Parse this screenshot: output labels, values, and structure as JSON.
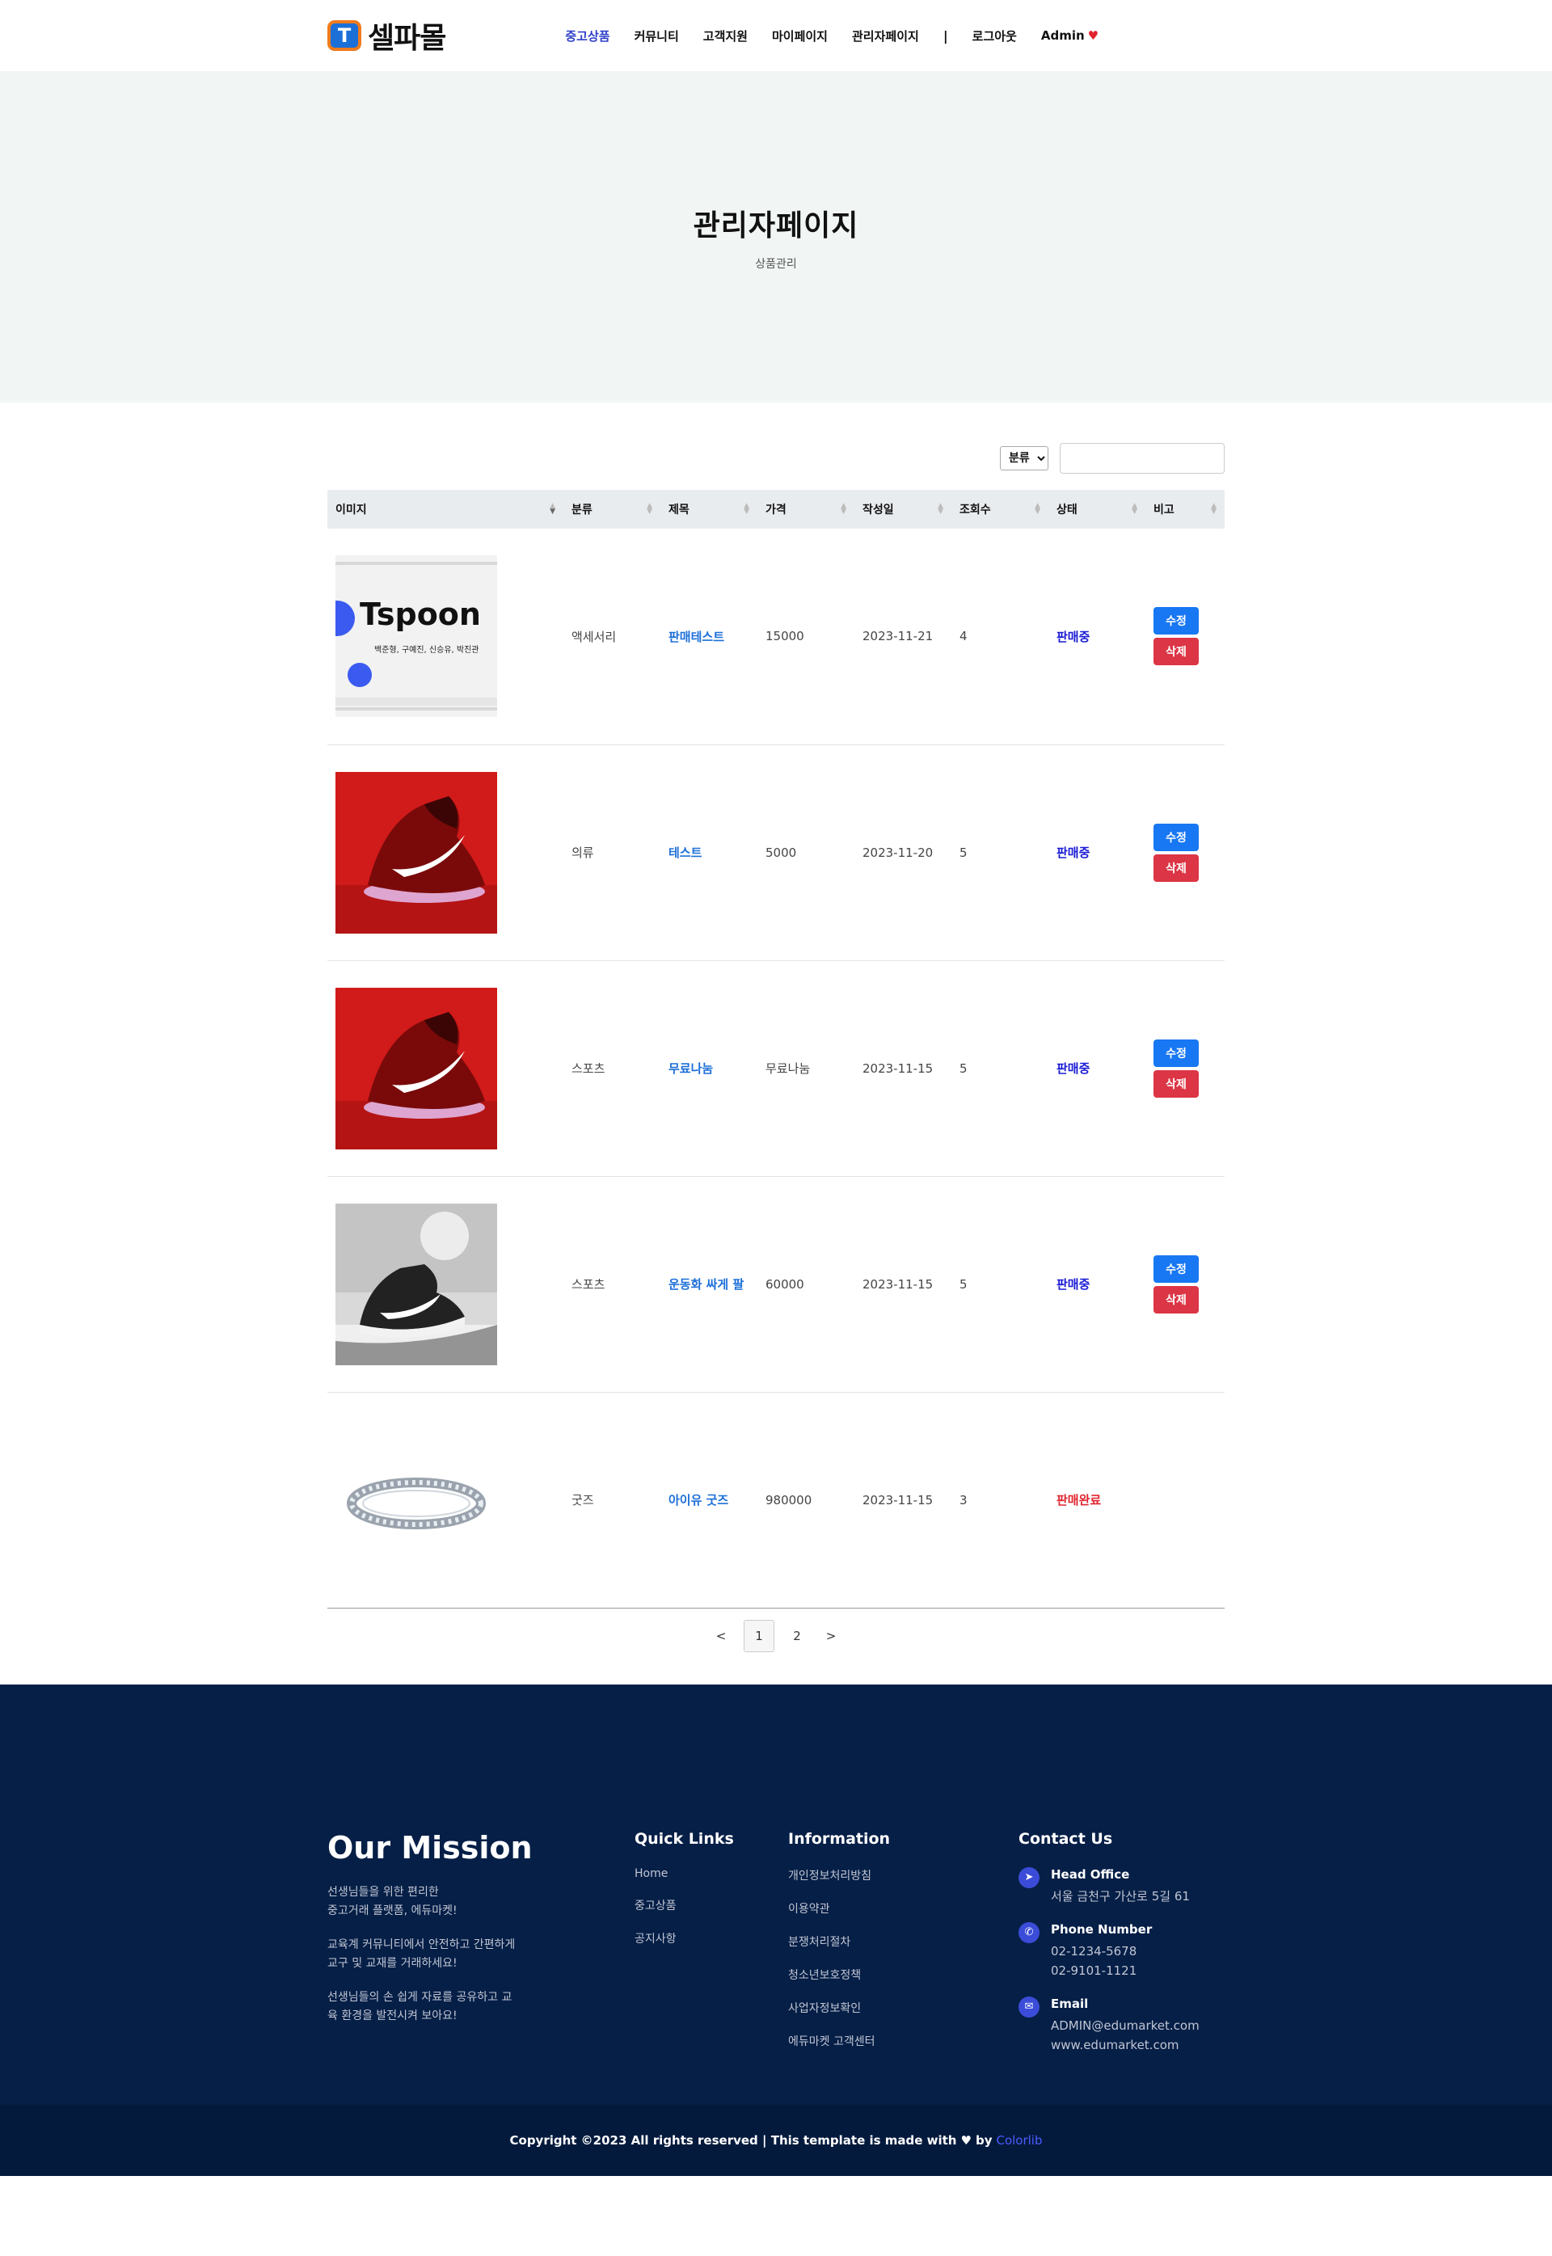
{
  "brand": {
    "logo_letter": "T",
    "name": "셀파몰"
  },
  "nav": {
    "items": [
      "중고상품",
      "커뮤니티",
      "고객지원",
      "마이페이지",
      "관리자페이지"
    ],
    "separator": "|",
    "logout": "로그아웃",
    "user": "Admin"
  },
  "hero": {
    "title": "관리자페이지",
    "subtitle": "상품관리"
  },
  "filter": {
    "select_value": "분류",
    "search_value": ""
  },
  "table": {
    "headers": [
      "이미지",
      "분류",
      "제목",
      "가격",
      "작성일",
      "조회수",
      "상태",
      "비고"
    ],
    "rows": [
      {
        "image": "tspoon-banner-image",
        "category": "액세서리",
        "title": "판매테스트",
        "price": "15000",
        "date": "2023-11-21",
        "views": "4",
        "status": "판매중",
        "edit": "수정",
        "delete": "삭제"
      },
      {
        "image": "red-sneaker-image",
        "category": "의류",
        "title": "테스트",
        "price": "5000",
        "date": "2023-11-20",
        "views": "5",
        "status": "판매중",
        "edit": "수정",
        "delete": "삭제"
      },
      {
        "image": "red-sneaker-image",
        "category": "스포츠",
        "title": "무료나눔",
        "price": "무료나눔",
        "date": "2023-11-15",
        "views": "5",
        "status": "판매중",
        "edit": "수정",
        "delete": "삭제"
      },
      {
        "image": "black-sneaker-image",
        "category": "스포츠",
        "title": "운동화 싸게 팔",
        "price": "60000",
        "date": "2023-11-15",
        "views": "5",
        "status": "판매중",
        "edit": "수정",
        "delete": "삭제"
      },
      {
        "image": "diamond-ring-image",
        "category": "굿즈",
        "title": "아이유 굿즈",
        "price": "980000",
        "date": "2023-11-15",
        "views": "3",
        "status": "판매완료"
      }
    ],
    "thumb_text": {
      "title": "Tspoon",
      "members": "백준형, 구예진, 신승유, 박진관"
    }
  },
  "pagination": {
    "prev": "<",
    "pages": [
      "1",
      "2"
    ],
    "current": "1",
    "next": ">"
  },
  "footer": {
    "mission": {
      "title": "Our Mission",
      "paragraphs": [
        "선생님들을 위한 편리한\n중고거래 플랫폼, 에듀마켓!",
        "교육계 커뮤니티에서 안전하고 간편하게\n교구 및 교재를 거래하세요!",
        "선생님들의 손 쉽게 자료를 공유하고 교\n육 환경을 발전시켜 보아요!"
      ]
    },
    "quick_links": {
      "title": "Quick Links",
      "items": [
        "Home",
        "중고상품",
        "공지사항"
      ]
    },
    "information": {
      "title": "Information",
      "items": [
        "개인정보처리방침",
        "이용약관",
        "분쟁처리절차",
        "청소년보호정책",
        "사업자정보확인",
        "에듀마켓 고객센터"
      ]
    },
    "contact": {
      "title": "Contact Us",
      "office": {
        "label": "Head Office",
        "lines": [
          "서울 금천구 가산로 5길 61"
        ]
      },
      "phone": {
        "label": "Phone Number",
        "lines": [
          "02-1234-5678",
          "02-9101-1121"
        ]
      },
      "email": {
        "label": "Email",
        "lines": [
          "ADMIN@edumarket.com",
          "www.edumarket.com"
        ]
      }
    },
    "copyright": {
      "text": "Copyright ©2023 All rights reserved | This template is made with",
      "by": "by",
      "brand": "Colorlib"
    }
  },
  "colors": {
    "accent": "#2f3fc9",
    "footer_bg": "#061f47",
    "edit_button": "#1877f2",
    "delete_button": "#dc3545",
    "status_on": "#1a1ad6",
    "status_off": "#e0242f"
  }
}
